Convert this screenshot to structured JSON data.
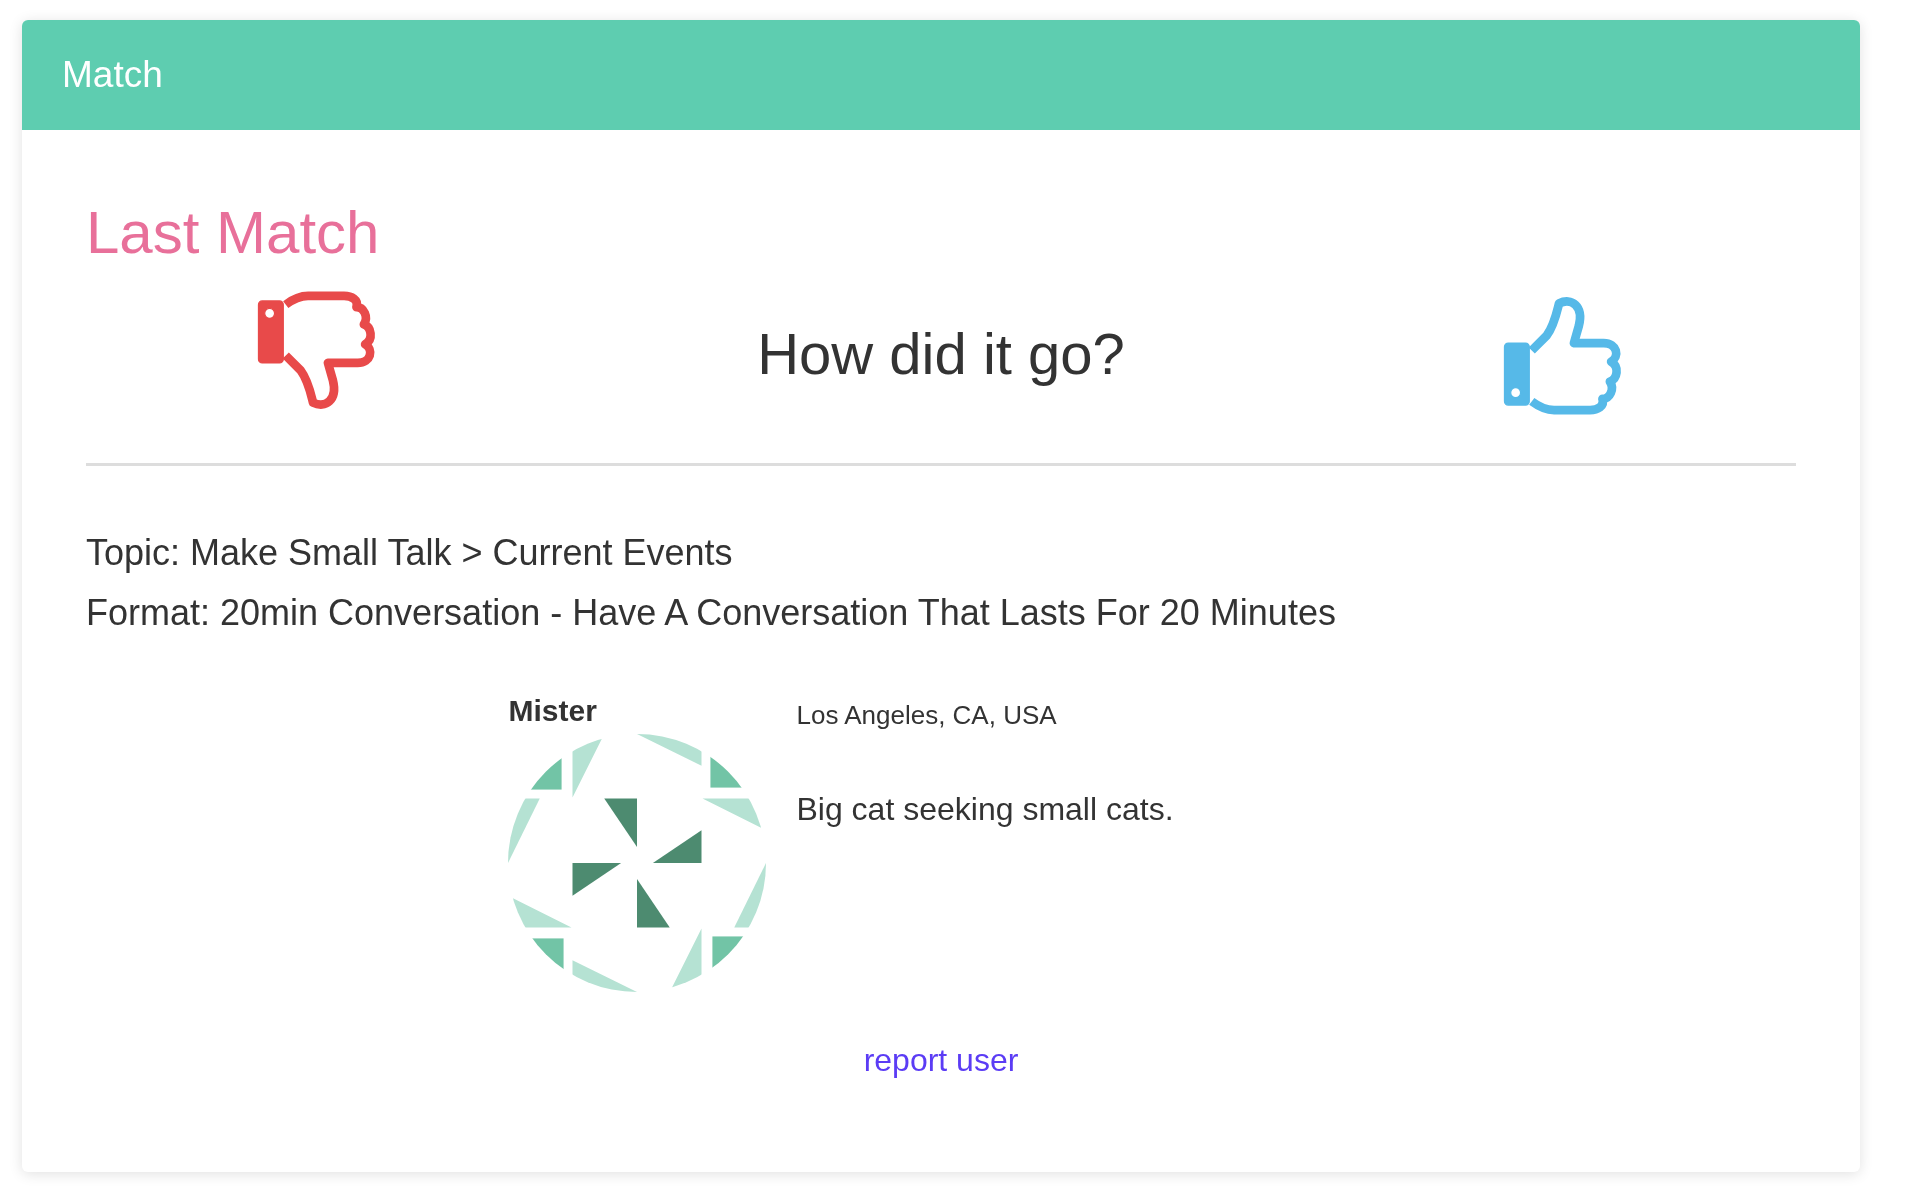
{
  "header": {
    "title": "Match"
  },
  "heading": "Last Match",
  "rating": {
    "question": "How did it go?"
  },
  "details": [
    "Topic: Make Small Talk > Current Events",
    "Format: 20min Conversation - Have A Conversation That Lasts For 20 Minutes"
  ],
  "profile": {
    "name": "Mister",
    "location": "Los Angeles, CA, USA",
    "bio": "Big cat seeking small cats."
  },
  "report_link": "report user"
}
